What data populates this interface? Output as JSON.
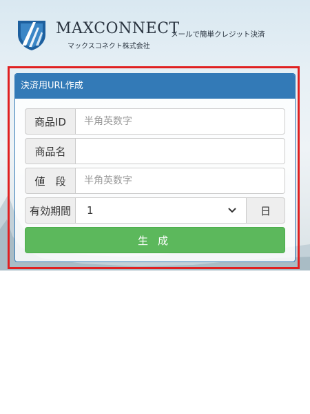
{
  "header": {
    "brand": "MAXCONNECT",
    "tagline": "メールで簡単クレジット決済",
    "company": "マックスコネクト株式会社"
  },
  "panel": {
    "title": "決済用URL作成"
  },
  "form": {
    "product_id": {
      "label": "商品ID",
      "value": "",
      "placeholder": "半角英数字"
    },
    "product_name": {
      "label": "商品名",
      "value": "",
      "placeholder": ""
    },
    "price": {
      "label": "値　段",
      "value": "",
      "placeholder": "半角英数字"
    },
    "validity": {
      "label": "有効期間",
      "selected": "1",
      "unit": "日"
    },
    "submit_label": "生成"
  },
  "colors": {
    "panel_primary": "#337ab7",
    "button_success": "#5cb85c",
    "highlight_border": "#e02020"
  }
}
